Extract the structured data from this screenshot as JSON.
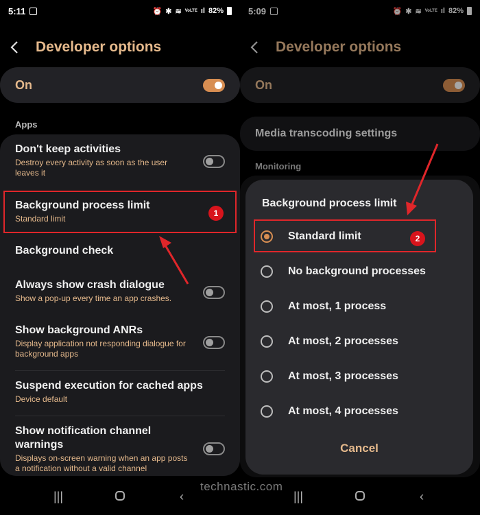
{
  "left": {
    "status": {
      "time": "5:11",
      "battery": "82%",
      "net": "VoLTE"
    },
    "appbar_title": "Developer options",
    "master": {
      "label": "On",
      "on": true
    },
    "section": "Apps",
    "rows": [
      {
        "title": "Don't keep activities",
        "sub": "Destroy every activity as soon as the user leaves it",
        "toggle": false
      },
      {
        "title": "Background process limit",
        "sub": "Standard limit"
      },
      {
        "title": "Background check"
      },
      {
        "title": "Always show crash dialogue",
        "sub": "Show a pop-up every time an app crashes.",
        "toggle": false
      },
      {
        "title": "Show background ANRs",
        "sub": "Display application not responding dialogue for background apps",
        "toggle": false
      },
      {
        "title": "Suspend execution for cached apps",
        "sub": "Device default"
      },
      {
        "title": "Show notification channel warnings",
        "sub": "Displays on-screen warning when an app posts a notification without a valid channel",
        "toggle": false
      }
    ],
    "badge": "1"
  },
  "right": {
    "status": {
      "time": "5:09",
      "battery": "82%",
      "net": "VoLTE"
    },
    "appbar_title": "Developer options",
    "master": {
      "label": "On",
      "on": true
    },
    "media_row": "Media transcoding settings",
    "section": "Monitoring",
    "dialog": {
      "title": "Background process limit",
      "options": [
        {
          "label": "Standard limit",
          "selected": true
        },
        {
          "label": "No background processes",
          "selected": false
        },
        {
          "label": "At most, 1 process",
          "selected": false
        },
        {
          "label": "At most, 2 processes",
          "selected": false
        },
        {
          "label": "At most, 3 processes",
          "selected": false
        },
        {
          "label": "At most, 4 processes",
          "selected": false
        }
      ],
      "cancel": "Cancel"
    },
    "badge": "2"
  },
  "nav": {
    "recents": "|||",
    "back": "‹"
  },
  "watermark": "technastic.com",
  "colors": {
    "accent": "#e5b98c",
    "toggle_on": "#d88e52",
    "annotation": "#e0262a"
  }
}
